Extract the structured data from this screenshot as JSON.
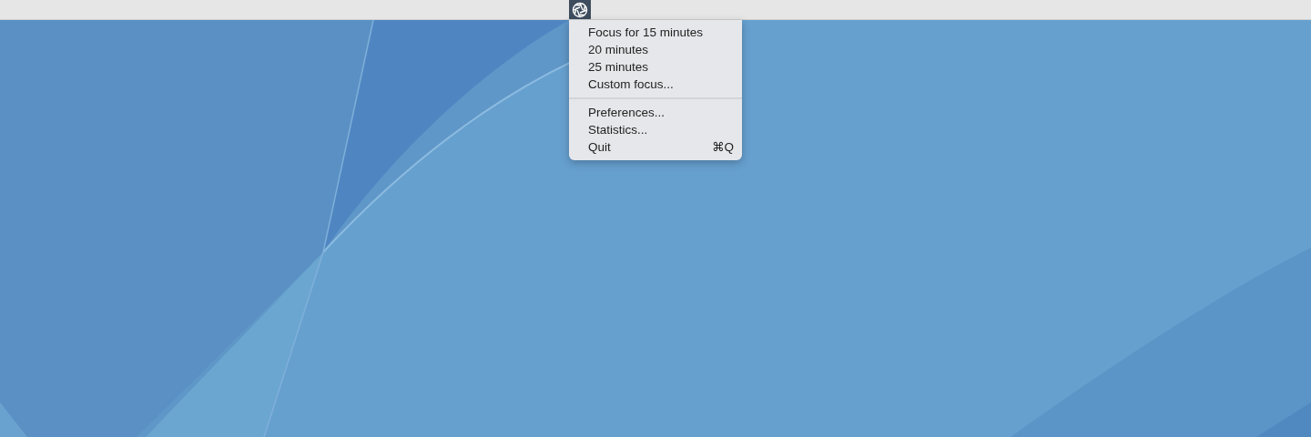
{
  "menu_bar": {
    "status_item": {
      "selected": true
    }
  },
  "menu": {
    "sections": [
      {
        "items": [
          {
            "label": "Focus for 15 minutes"
          },
          {
            "label": "20 minutes"
          },
          {
            "label": "25 minutes"
          },
          {
            "label": "Custom focus..."
          }
        ]
      },
      {
        "items": [
          {
            "label": "Preferences..."
          },
          {
            "label": "Statistics..."
          },
          {
            "label": "Quit",
            "shortcut": "⌘Q"
          }
        ]
      }
    ]
  }
}
